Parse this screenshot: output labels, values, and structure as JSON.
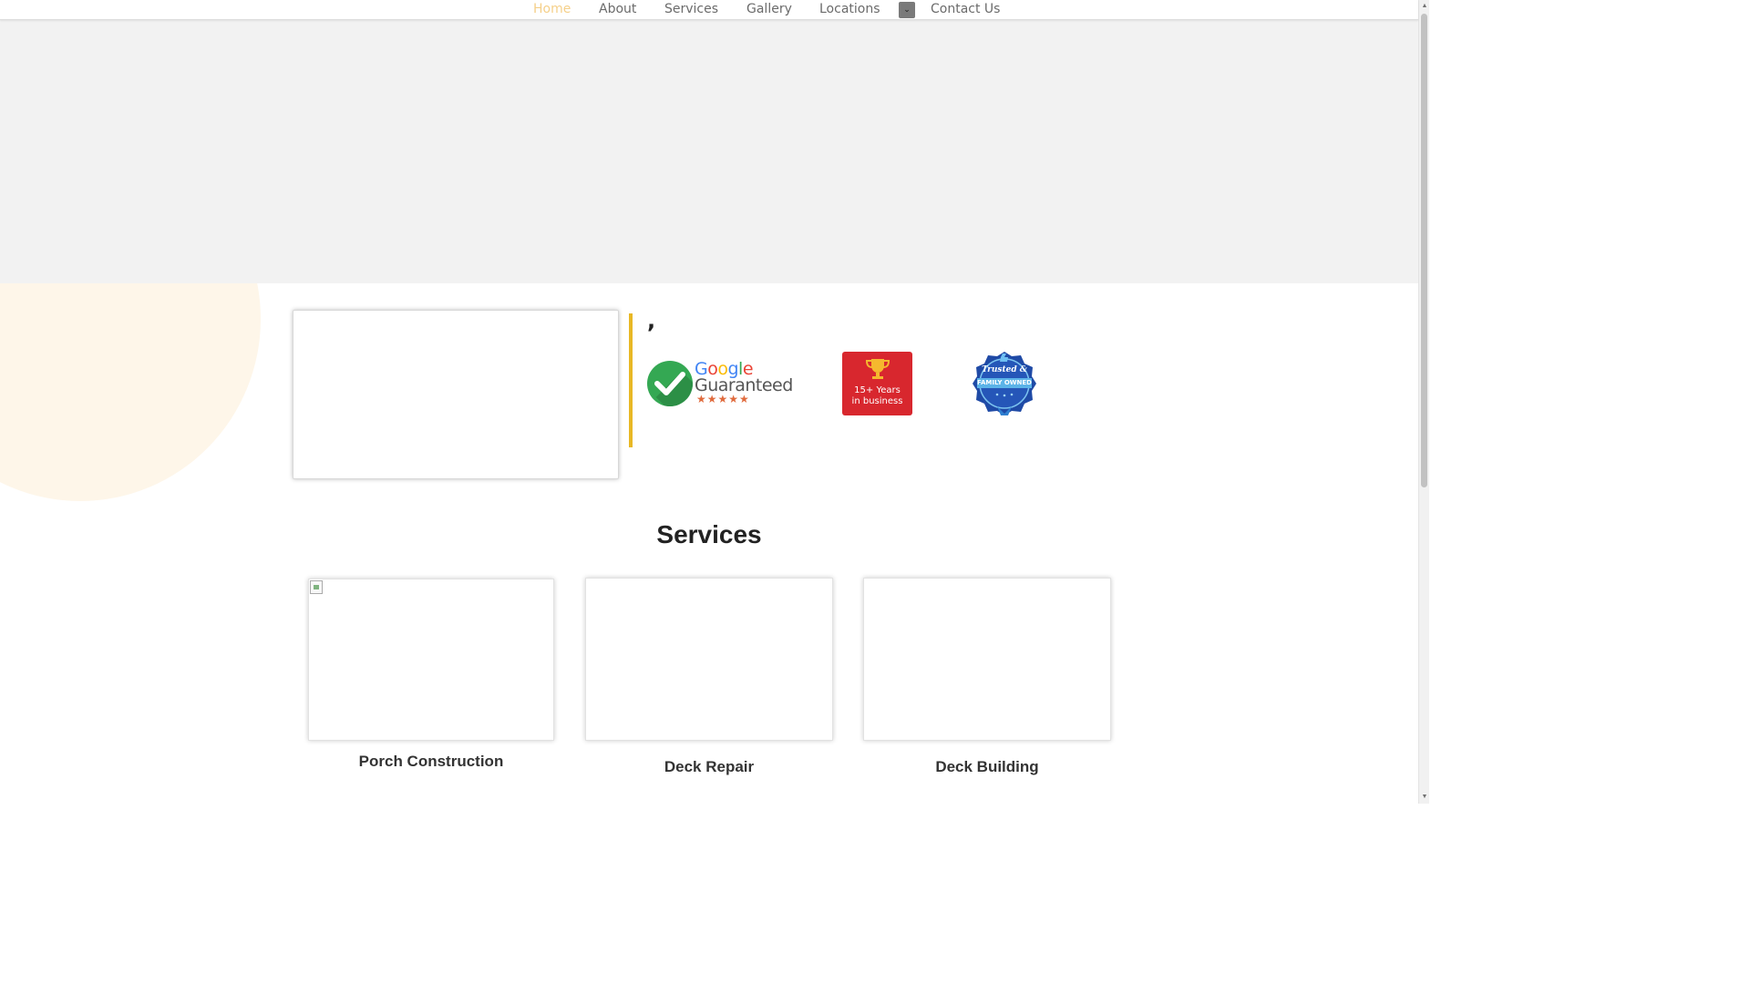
{
  "nav": {
    "items": [
      {
        "label": "Home",
        "active": true
      },
      {
        "label": "About"
      },
      {
        "label": "Services"
      },
      {
        "label": "Gallery"
      },
      {
        "label": "Locations"
      },
      {
        "label": "Contact Us"
      }
    ],
    "active_color": "#f5d08a",
    "text_color": "#6b6b6b"
  },
  "intro": {
    "heading": ","
  },
  "badges": {
    "google": {
      "word": [
        "G",
        "o",
        "o",
        "g",
        "l",
        "e"
      ],
      "word_colors": [
        "#4285f4",
        "#ea4335",
        "#fbbc05",
        "#4285f4",
        "#34a853",
        "#ea4335"
      ],
      "sub": "Guaranteed",
      "stars": "★★★★★"
    },
    "years": {
      "line1": "15+ Years",
      "line2": "in business",
      "color": "#d8272e"
    },
    "trusted": {
      "line1": "Trusted &",
      "line2": "FAMILY OWNED"
    }
  },
  "services": {
    "title": "Services",
    "items": [
      {
        "label": "Porch Construction"
      },
      {
        "label": "Deck Repair"
      },
      {
        "label": "Deck Building"
      }
    ]
  },
  "colors": {
    "accent_bar": "#e8b825",
    "hero_bg": "#f2f2f2",
    "decor_circle": "#fef6e9"
  }
}
